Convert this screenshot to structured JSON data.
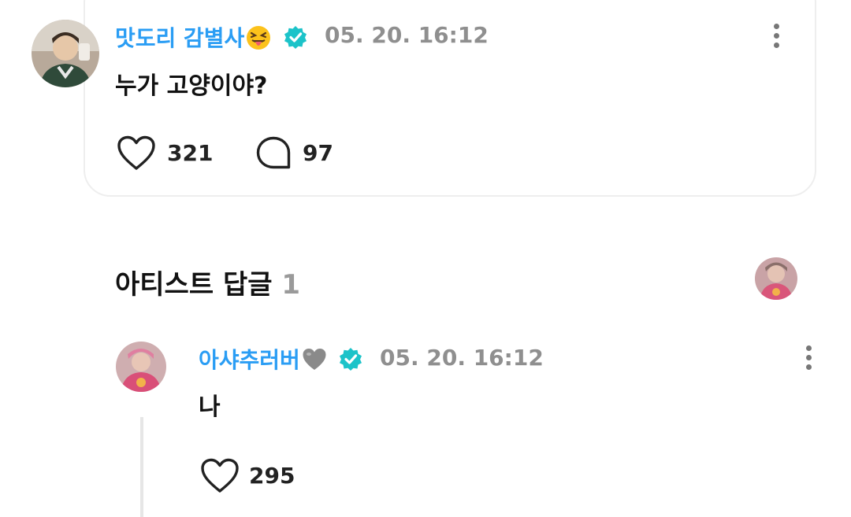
{
  "post": {
    "author": "맛도리 감별사",
    "timestamp": "05. 20. 16:12",
    "text": "누가 고양이야?",
    "like_count": "321",
    "comment_count": "97"
  },
  "artist_replies": {
    "title": "아티스트 답글",
    "count": "1"
  },
  "reply": {
    "author": "아샤추러버",
    "timestamp": "05. 20. 16:12",
    "text": "나",
    "like_count": "295"
  },
  "colors": {
    "accent": "#2a9df4",
    "verified": "#1cc3c9",
    "muted": "#8f8f8f"
  },
  "icons": [
    "tongue-emoji-icon",
    "verified-badge-icon",
    "more-options-icon",
    "heart-icon",
    "comment-icon",
    "grey-heart-emoji-icon"
  ]
}
